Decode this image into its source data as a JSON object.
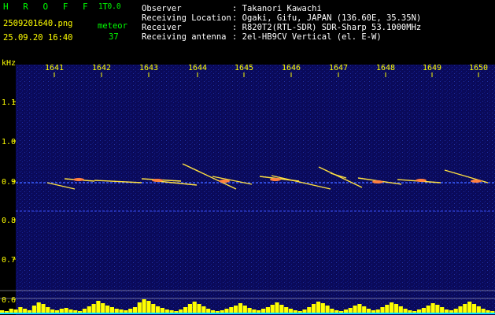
{
  "app": {
    "name": "H R O F F T",
    "version": "1.0.0"
  },
  "file": {
    "name": "2509201640.png",
    "datetime": "25.09.20 16:40"
  },
  "meteor": {
    "label": "meteor",
    "count": "37"
  },
  "info": [
    {
      "label": "Observer",
      "value": ": Takanori Kawachi"
    },
    {
      "label": "Receiving Location",
      "value": ": Ogaki, Gifu, JAPAN (136.60E, 35.35N)"
    },
    {
      "label": "Receiver",
      "value": ": R820T2(RTL-SDR) SDR-Sharp 53.1000MHz"
    },
    {
      "label": "Receiving antenna",
      "value": ": 2el-HB9CV Vertical (el. E-W)"
    }
  ],
  "axes": {
    "y_unit": "kHz",
    "time_ticks": [
      "1641",
      "1642",
      "1643",
      "1644",
      "1645",
      "1646",
      "1647",
      "1648",
      "1649",
      "1650"
    ],
    "freq_ticks": [
      "1.1",
      "1.0",
      "0.9",
      "0.8",
      "0.7",
      "0.6"
    ]
  },
  "colors": {
    "background": "#000000",
    "spectrum_bg": "#0a0a60",
    "carrier": "#3a5cff",
    "meteor_trace": "#ffe040",
    "level_bars": "#ffff00",
    "baseline": "#00e0ff",
    "axis_text": "#ffff00",
    "info_text": "#ffffff"
  }
}
